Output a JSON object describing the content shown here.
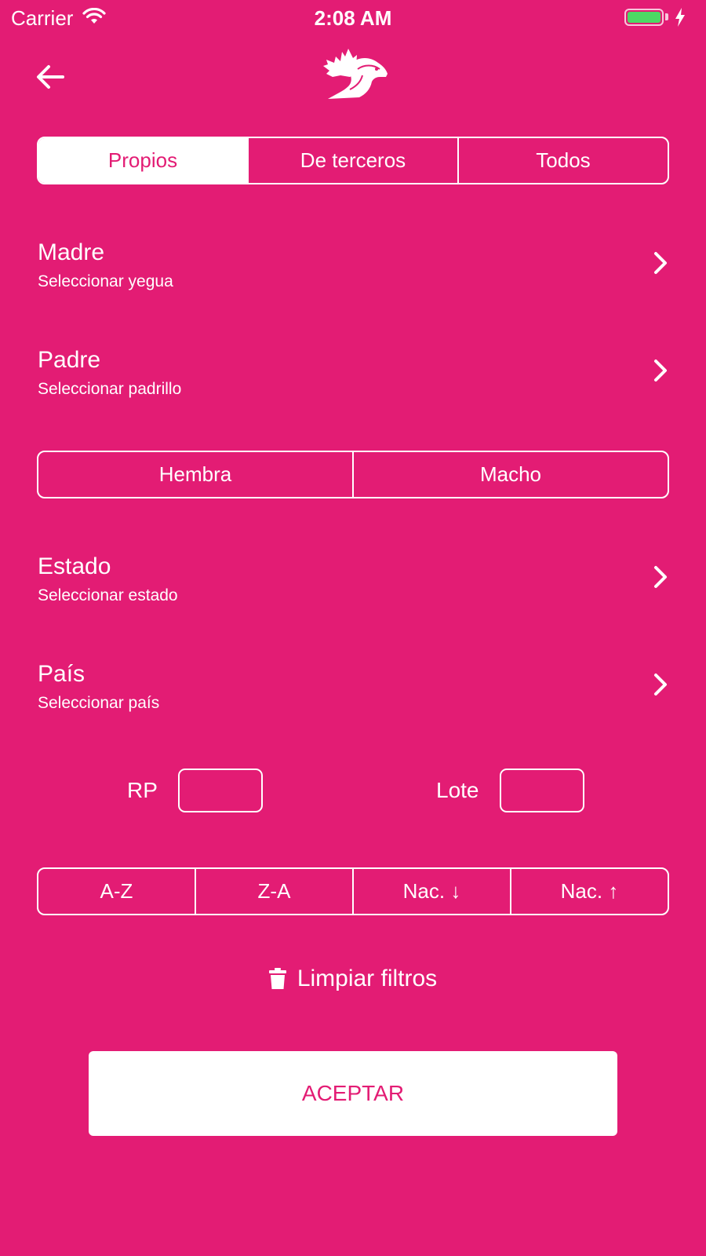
{
  "status_bar": {
    "carrier": "Carrier",
    "time": "2:08 AM",
    "battery_level": 1.0,
    "battery_color": "#4cd964"
  },
  "header": {
    "back_icon": "arrow-left-icon",
    "logo_icon": "maple-leaf-horse-logo"
  },
  "ownership_tabs": {
    "items": [
      {
        "label": "Propios",
        "active": true
      },
      {
        "label": "De terceros",
        "active": false
      },
      {
        "label": "Todos",
        "active": false
      }
    ]
  },
  "filters": {
    "madre": {
      "title": "Madre",
      "subtitle": "Seleccionar yegua"
    },
    "padre": {
      "title": "Padre",
      "subtitle": "Seleccionar padrillo"
    },
    "estado": {
      "title": "Estado",
      "subtitle": "Seleccionar estado"
    },
    "pais": {
      "title": "País",
      "subtitle": "Seleccionar país"
    }
  },
  "sex_toggle": {
    "items": [
      {
        "label": "Hembra"
      },
      {
        "label": "Macho"
      }
    ]
  },
  "inputs": {
    "rp": {
      "label": "RP",
      "value": ""
    },
    "lote": {
      "label": "Lote",
      "value": ""
    }
  },
  "sort": {
    "items": [
      {
        "label": "A-Z"
      },
      {
        "label": "Z-A"
      },
      {
        "label": "Nac. ↓"
      },
      {
        "label": "Nac. ↑"
      }
    ]
  },
  "clear_filters": {
    "label": "Limpiar filtros",
    "icon": "trash-icon"
  },
  "accept_button": {
    "label": "ACEPTAR"
  },
  "colors": {
    "background": "#e31c74",
    "foreground": "#ffffff"
  }
}
